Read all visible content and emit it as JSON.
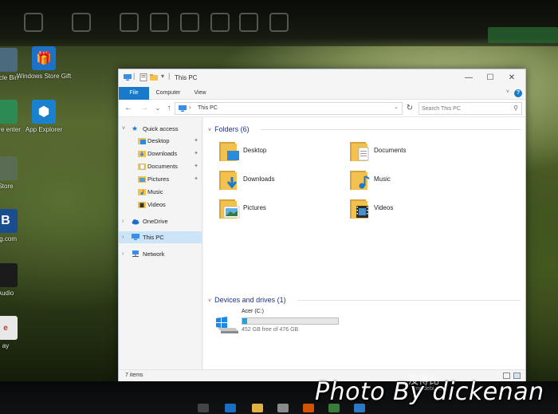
{
  "window": {
    "title": "This PC",
    "controls": {
      "minimize": "—",
      "maximize": "☐",
      "close": "✕"
    }
  },
  "ribbon": {
    "tabs": [
      {
        "label": "File"
      },
      {
        "label": "Computer"
      },
      {
        "label": "View"
      }
    ],
    "help_label": "?"
  },
  "address": {
    "back": "←",
    "forward": "→",
    "recent": "⌄",
    "up": "↑",
    "separator": "›",
    "path": "This PC",
    "dropdown": "⌄",
    "refresh": "↻",
    "search_placeholder": "Search This PC",
    "search_glyph": "⚲"
  },
  "navpane": {
    "quick_access": "Quick access",
    "items": [
      {
        "label": "Desktop",
        "pinned": true
      },
      {
        "label": "Downloads",
        "pinned": true
      },
      {
        "label": "Documents",
        "pinned": true
      },
      {
        "label": "Pictures",
        "pinned": true
      },
      {
        "label": "Music",
        "pinned": false
      },
      {
        "label": "Videos",
        "pinned": false
      }
    ],
    "onedrive": "OneDrive",
    "this_pc": "This PC",
    "network": "Network",
    "chevron_open": "˅",
    "chevron_closed": "›",
    "pin_glyph": "📌"
  },
  "content": {
    "folders_header": "Folders (6)",
    "folders": [
      {
        "label": "Desktop"
      },
      {
        "label": "Documents"
      },
      {
        "label": "Downloads"
      },
      {
        "label": "Music"
      },
      {
        "label": "Pictures"
      },
      {
        "label": "Videos"
      }
    ],
    "devices_header": "Devices and drives (1)",
    "drive": {
      "name": "Acer (C:)",
      "free_text": "452 GB free of 476 GB",
      "used_fraction": 0.05
    }
  },
  "status": {
    "items_text": "7 items"
  },
  "desktop": {
    "icons": [
      {
        "label": "Windows Store Gift"
      },
      {
        "label": "App Explorer"
      }
    ],
    "edge_labels": [
      "cycle Bin",
      "Care enter",
      "Store",
      "ing.com",
      "Audio",
      "ay"
    ]
  },
  "watermark": {
    "photo_credit": "Photo By dickenan",
    "cn_text": "没得比",
    "site": "meidebi.com"
  },
  "colors": {
    "accent": "#1979ca",
    "folder_yellow": "#f2c14e",
    "folder_dark": "#d9a53a",
    "selection": "#cce4f7",
    "drive_fill": "#26a0da",
    "group_header": "#1e3287"
  }
}
